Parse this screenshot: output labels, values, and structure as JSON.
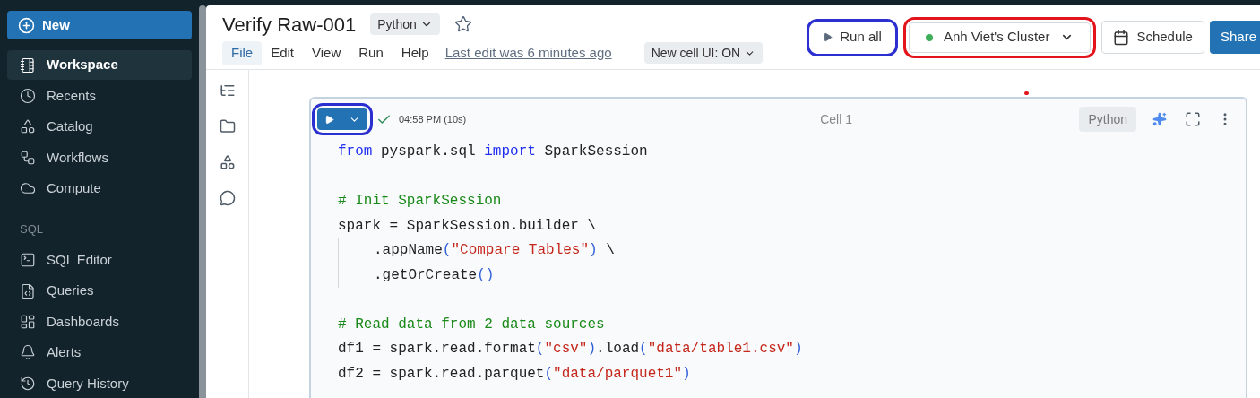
{
  "sidebar": {
    "new_button": "New",
    "items": [
      {
        "label": "Workspace",
        "selected": true
      },
      {
        "label": "Recents",
        "selected": false
      },
      {
        "label": "Catalog",
        "selected": false
      },
      {
        "label": "Workflows",
        "selected": false
      },
      {
        "label": "Compute",
        "selected": false
      }
    ],
    "section": "SQL",
    "sql_items": [
      {
        "label": "SQL Editor",
        "selected": false
      },
      {
        "label": "Queries",
        "selected": false
      },
      {
        "label": "Dashboards",
        "selected": false
      },
      {
        "label": "Alerts",
        "selected": false
      },
      {
        "label": "Query History",
        "selected": false
      }
    ]
  },
  "header": {
    "title": "Verify Raw-001",
    "language": "Python",
    "starred": false,
    "menu": [
      {
        "label": "File",
        "selected": true
      },
      {
        "label": "Edit",
        "selected": false
      },
      {
        "label": "View",
        "selected": false
      },
      {
        "label": "Run",
        "selected": false
      },
      {
        "label": "Help",
        "selected": false
      }
    ],
    "last_edit": "Last edit was 6 minutes ago",
    "cell_ui": "New cell UI: ON",
    "run_all": "Run all",
    "cluster": {
      "name": "Anh Viet's Cluster",
      "color": "#3fae5a"
    },
    "schedule": "Schedule",
    "share": "Share"
  },
  "annotations": [
    {
      "color": "#2b2fcf"
    },
    {
      "color": "#e3141b"
    },
    {
      "color": "#2b2fcf"
    }
  ],
  "cell": {
    "status": "04:58 PM (10s)",
    "succeeded": true,
    "name": "Cell 1",
    "language": "Python",
    "lines": [
      {
        "kind": "code",
        "indent": false,
        "tokens": [
          {
            "kind": "keyword",
            "text": "from"
          },
          {
            "kind": "plain",
            "text": " pyspark.sql "
          },
          {
            "kind": "keyword",
            "text": "import"
          },
          {
            "kind": "plain",
            "text": " SparkSession"
          }
        ]
      },
      {
        "kind": "blank"
      },
      {
        "kind": "code",
        "indent": false,
        "tokens": [
          {
            "kind": "comment",
            "text": "# Init SparkSession"
          }
        ]
      },
      {
        "kind": "code",
        "indent": false,
        "tokens": [
          {
            "kind": "plain",
            "text": "spark = SparkSession.builder \\"
          }
        ]
      },
      {
        "kind": "code",
        "indent": true,
        "tokens": [
          {
            "kind": "plain",
            "text": ".appName"
          },
          {
            "kind": "paren",
            "text": "("
          },
          {
            "kind": "string",
            "text": "\"Compare Tables\""
          },
          {
            "kind": "paren",
            "text": ")"
          },
          {
            "kind": "plain",
            "text": " \\"
          }
        ]
      },
      {
        "kind": "code",
        "indent": true,
        "tokens": [
          {
            "kind": "plain",
            "text": ".getOrCreate"
          },
          {
            "kind": "paren",
            "text": "()"
          }
        ]
      },
      {
        "kind": "blank"
      },
      {
        "kind": "code",
        "indent": false,
        "tokens": [
          {
            "kind": "comment",
            "text": "# Read data from 2 data sources"
          }
        ]
      },
      {
        "kind": "code",
        "indent": false,
        "tokens": [
          {
            "kind": "plain",
            "text": "df1 = spark.read.format"
          },
          {
            "kind": "paren",
            "text": "("
          },
          {
            "kind": "string",
            "text": "\"csv\""
          },
          {
            "kind": "paren",
            "text": ")"
          },
          {
            "kind": "plain",
            "text": ".load"
          },
          {
            "kind": "paren",
            "text": "("
          },
          {
            "kind": "string",
            "text": "\"data/table1.csv\""
          },
          {
            "kind": "paren",
            "text": ")"
          }
        ]
      },
      {
        "kind": "code",
        "indent": false,
        "tokens": [
          {
            "kind": "plain",
            "text": "df2 = spark.read.parquet"
          },
          {
            "kind": "paren",
            "text": "("
          },
          {
            "kind": "string",
            "text": "\"data/parquet1\""
          },
          {
            "kind": "paren",
            "text": ")"
          }
        ]
      }
    ]
  }
}
